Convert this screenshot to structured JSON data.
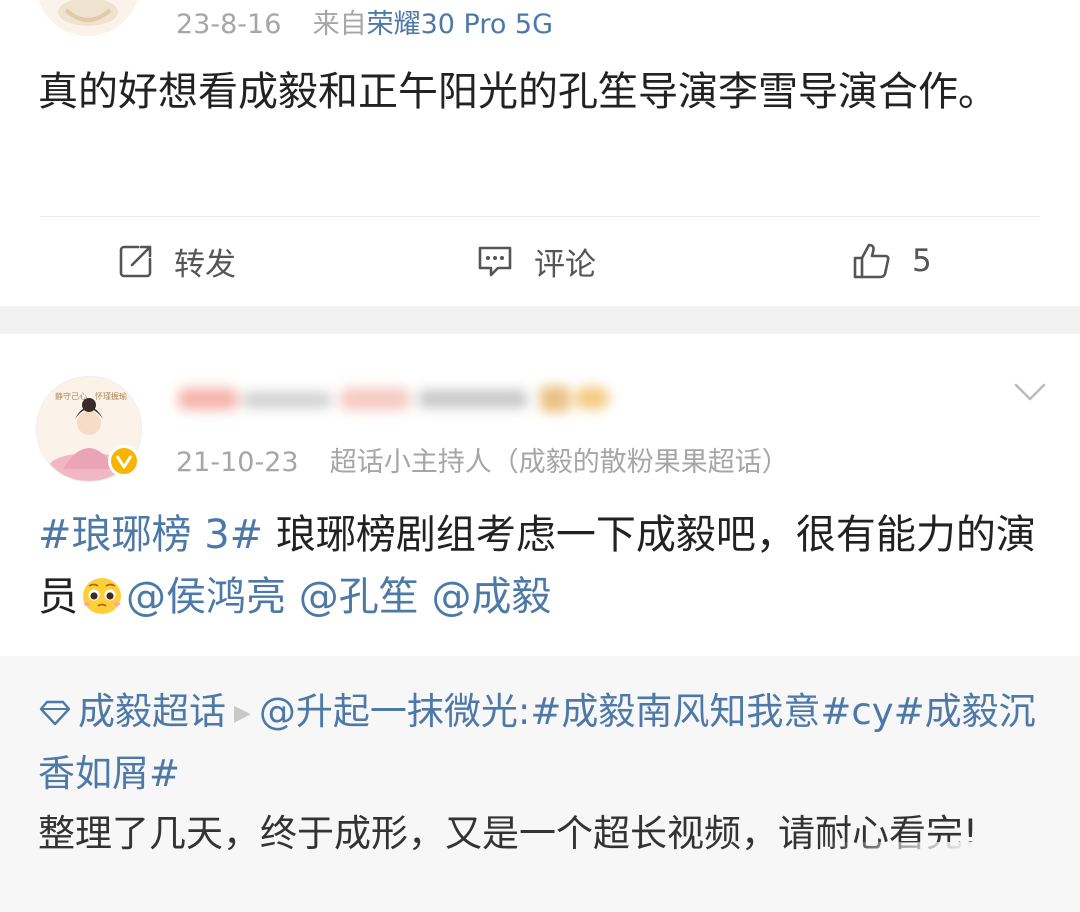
{
  "post1": {
    "date": "23-8-16",
    "source_prefix": "来自",
    "device": "荣耀30 Pro 5G",
    "text": "真的好想看成毅和正午阳光的孔笙导演李雪导演合作。",
    "actions": {
      "repost": "转发",
      "comment": "评论",
      "like_count": "5"
    }
  },
  "post2": {
    "date": "21-10-23",
    "role": "超话小主持人（成毅的散粉果果超话）",
    "hashtag": "#琅琊榜 3#",
    "text": "琅琊榜剧组考虑一下成毅吧，很有能力的演员",
    "mentions": [
      "@侯鸿亮",
      "@孔笙",
      "@成毅"
    ],
    "avatar_caption": "静守己心　怀瑾握瑜"
  },
  "repost": {
    "topic": "成毅超话",
    "user": "@升起一抹微光:",
    "tags": "#成毅南风知我意#cy#成毅沉香如屑#",
    "text": "整理了几天，终于成形，又是一个超长视频，请耐心看完!"
  },
  "colors": {
    "link": "#4d79a8",
    "meta": "#a6a6a6",
    "badge": "#f7b500"
  }
}
